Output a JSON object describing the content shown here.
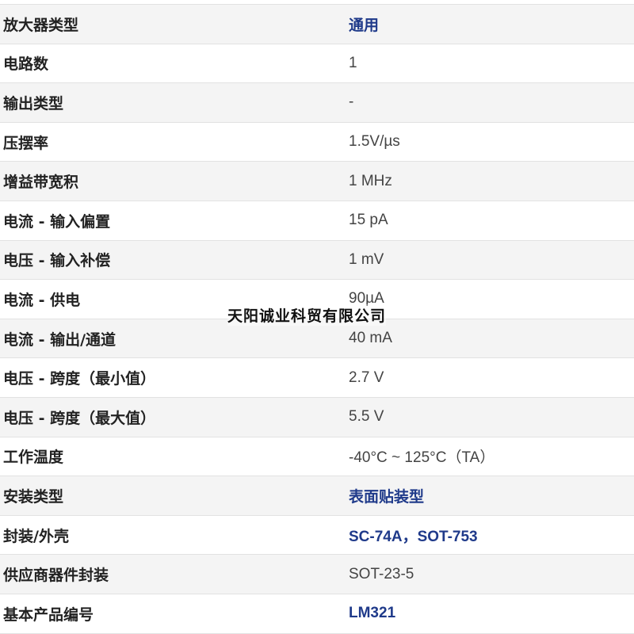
{
  "specs": [
    {
      "label": "放大器类型",
      "value": "通用",
      "link": true
    },
    {
      "label": "电路数",
      "value": "1",
      "link": false
    },
    {
      "label": "输出类型",
      "value": "-",
      "link": false
    },
    {
      "label": "压摆率",
      "value": "1.5V/µs",
      "link": false
    },
    {
      "label": "增益带宽积",
      "value": "1 MHz",
      "link": false
    },
    {
      "label": "电流 - 输入偏置",
      "value": "15 pA",
      "link": false
    },
    {
      "label": "电压 - 输入补偿",
      "value": "1 mV",
      "link": false
    },
    {
      "label": "电流 - 供电",
      "value": "90µA",
      "link": false
    },
    {
      "label": "电流 - 输出/通道",
      "value": "40 mA",
      "link": false
    },
    {
      "label": "电压 - 跨度（最小值）",
      "value": "2.7 V",
      "link": false
    },
    {
      "label": "电压 - 跨度（最大值）",
      "value": "5.5 V",
      "link": false
    },
    {
      "label": "工作温度",
      "value": "-40°C ~ 125°C（TA）",
      "link": false
    },
    {
      "label": "安装类型",
      "value": "表面贴装型",
      "link": true
    },
    {
      "label": "封装/外壳",
      "value": "SC-74A，SOT-753",
      "link": true
    },
    {
      "label": "供应商器件封装",
      "value": "SOT-23-5",
      "link": false
    },
    {
      "label": "基本产品编号",
      "value": "LM321",
      "link": true
    }
  ],
  "watermark": "天阳诚业科贸有限公司",
  "colors": {
    "link": "#1f3a8a",
    "label": "#222222",
    "value": "#444444",
    "row_alt": "#f4f4f4",
    "border": "#e2e2e2"
  }
}
